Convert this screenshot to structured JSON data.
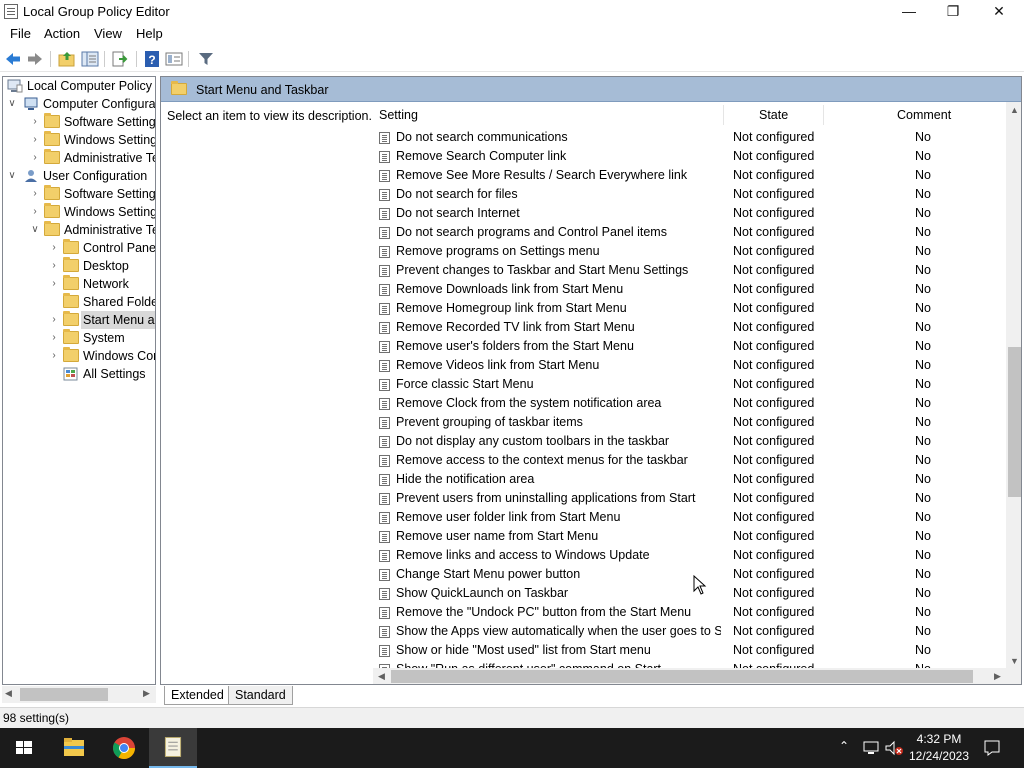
{
  "window": {
    "title": "Local Group Policy Editor",
    "minimize": "—",
    "maximize": "❐",
    "close": "✕"
  },
  "menu": [
    "File",
    "Action",
    "View",
    "Help"
  ],
  "toolbar": {
    "icons": [
      "back-arrow-icon",
      "forward-arrow-icon",
      "up-folder-icon",
      "show-hide-tree-icon",
      "export-list-icon",
      "help-icon",
      "properties-icon",
      "filter-icon"
    ]
  },
  "tree": {
    "items": [
      {
        "label": "Local Computer Policy",
        "level": 0,
        "arrow": "",
        "icon": "computer-policy-icon"
      },
      {
        "label": "Computer Configura",
        "level": 1,
        "arrow": "expanded",
        "icon": "computer-icon"
      },
      {
        "label": "Software Settings",
        "level": 2,
        "arrow": "collapsed",
        "icon": "folder-icon"
      },
      {
        "label": "Windows Setting",
        "level": 2,
        "arrow": "collapsed",
        "icon": "folder-icon"
      },
      {
        "label": "Administrative Te",
        "level": 2,
        "arrow": "collapsed",
        "icon": "folder-icon"
      },
      {
        "label": "User Configuration",
        "level": 1,
        "arrow": "expanded",
        "icon": "user-icon"
      },
      {
        "label": "Software Settings",
        "level": 2,
        "arrow": "collapsed",
        "icon": "folder-icon"
      },
      {
        "label": "Windows Setting",
        "level": 2,
        "arrow": "collapsed",
        "icon": "folder-icon"
      },
      {
        "label": "Administrative Te",
        "level": 2,
        "arrow": "expanded",
        "icon": "folder-icon"
      },
      {
        "label": "Control Panel",
        "level": 3,
        "arrow": "collapsed",
        "icon": "folder-icon"
      },
      {
        "label": "Desktop",
        "level": 3,
        "arrow": "collapsed",
        "icon": "folder-icon"
      },
      {
        "label": "Network",
        "level": 3,
        "arrow": "collapsed",
        "icon": "folder-icon"
      },
      {
        "label": "Shared Folder",
        "level": 3,
        "arrow": "",
        "icon": "folder-icon"
      },
      {
        "label": "Start Menu ar",
        "level": 3,
        "arrow": "collapsed",
        "icon": "folder-icon",
        "selected": true
      },
      {
        "label": "System",
        "level": 3,
        "arrow": "collapsed",
        "icon": "folder-icon"
      },
      {
        "label": "Windows Cor",
        "level": 3,
        "arrow": "collapsed",
        "icon": "folder-icon"
      },
      {
        "label": "All Settings",
        "level": 3,
        "arrow": "",
        "icon": "all-settings-icon"
      }
    ]
  },
  "content": {
    "header": "Start Menu and Taskbar",
    "description": "Select an item to view its description.",
    "columns": {
      "setting": "Setting",
      "state": "State",
      "comment": "Comment"
    },
    "rows": [
      {
        "name": "Do not search communications",
        "state": "Not configured",
        "comment": "No"
      },
      {
        "name": "Remove Search Computer link",
        "state": "Not configured",
        "comment": "No"
      },
      {
        "name": "Remove See More Results / Search Everywhere link",
        "state": "Not configured",
        "comment": "No"
      },
      {
        "name": "Do not search for files",
        "state": "Not configured",
        "comment": "No"
      },
      {
        "name": "Do not search Internet",
        "state": "Not configured",
        "comment": "No"
      },
      {
        "name": "Do not search programs and Control Panel items",
        "state": "Not configured",
        "comment": "No"
      },
      {
        "name": "Remove programs on Settings menu",
        "state": "Not configured",
        "comment": "No"
      },
      {
        "name": "Prevent changes to Taskbar and Start Menu Settings",
        "state": "Not configured",
        "comment": "No"
      },
      {
        "name": "Remove Downloads link from Start Menu",
        "state": "Not configured",
        "comment": "No"
      },
      {
        "name": "Remove Homegroup link from Start Menu",
        "state": "Not configured",
        "comment": "No"
      },
      {
        "name": "Remove Recorded TV link from Start Menu",
        "state": "Not configured",
        "comment": "No"
      },
      {
        "name": "Remove user's folders from the Start Menu",
        "state": "Not configured",
        "comment": "No"
      },
      {
        "name": "Remove Videos link from Start Menu",
        "state": "Not configured",
        "comment": "No"
      },
      {
        "name": "Force classic Start Menu",
        "state": "Not configured",
        "comment": "No"
      },
      {
        "name": "Remove Clock from the system notification area",
        "state": "Not configured",
        "comment": "No"
      },
      {
        "name": "Prevent grouping of taskbar items",
        "state": "Not configured",
        "comment": "No"
      },
      {
        "name": "Do not display any custom toolbars in the taskbar",
        "state": "Not configured",
        "comment": "No"
      },
      {
        "name": "Remove access to the context menus for the taskbar",
        "state": "Not configured",
        "comment": "No"
      },
      {
        "name": "Hide the notification area",
        "state": "Not configured",
        "comment": "No"
      },
      {
        "name": "Prevent users from uninstalling applications from Start",
        "state": "Not configured",
        "comment": "No"
      },
      {
        "name": "Remove user folder link from Start Menu",
        "state": "Not configured",
        "comment": "No"
      },
      {
        "name": "Remove user name from Start Menu",
        "state": "Not configured",
        "comment": "No"
      },
      {
        "name": "Remove links and access to Windows Update",
        "state": "Not configured",
        "comment": "No"
      },
      {
        "name": "Change Start Menu power button",
        "state": "Not configured",
        "comment": "No"
      },
      {
        "name": "Show QuickLaunch on Taskbar",
        "state": "Not configured",
        "comment": "No"
      },
      {
        "name": "Remove the \"Undock PC\" button from the Start Menu",
        "state": "Not configured",
        "comment": "No"
      },
      {
        "name": "Show the Apps view automatically when the user goes to St...",
        "state": "Not configured",
        "comment": "No"
      },
      {
        "name": "Show or hide \"Most used\" list from Start menu",
        "state": "Not configured",
        "comment": "No"
      },
      {
        "name": "Show \"Run as different user\" command on Start",
        "state": "Not configured",
        "comment": "No"
      }
    ]
  },
  "tabs": [
    "Extended",
    "Standard"
  ],
  "status": {
    "text": "98 setting(s)"
  },
  "taskbar": {
    "time": "4:32 PM",
    "date": "12/24/2023",
    "icons": [
      "start-icon",
      "file-explorer-icon",
      "chrome-icon",
      "notepad-icon"
    ],
    "tray": [
      "show-hidden-icons-icon",
      "network-icon",
      "volume-muted-icon",
      "notifications-icon"
    ]
  },
  "colors": {
    "header_bg": "#a6bcd6",
    "selection_bg": "#d9d9d9",
    "taskbar_bg": "#1b1b1b",
    "active_app_underline": "#76b9ed"
  }
}
